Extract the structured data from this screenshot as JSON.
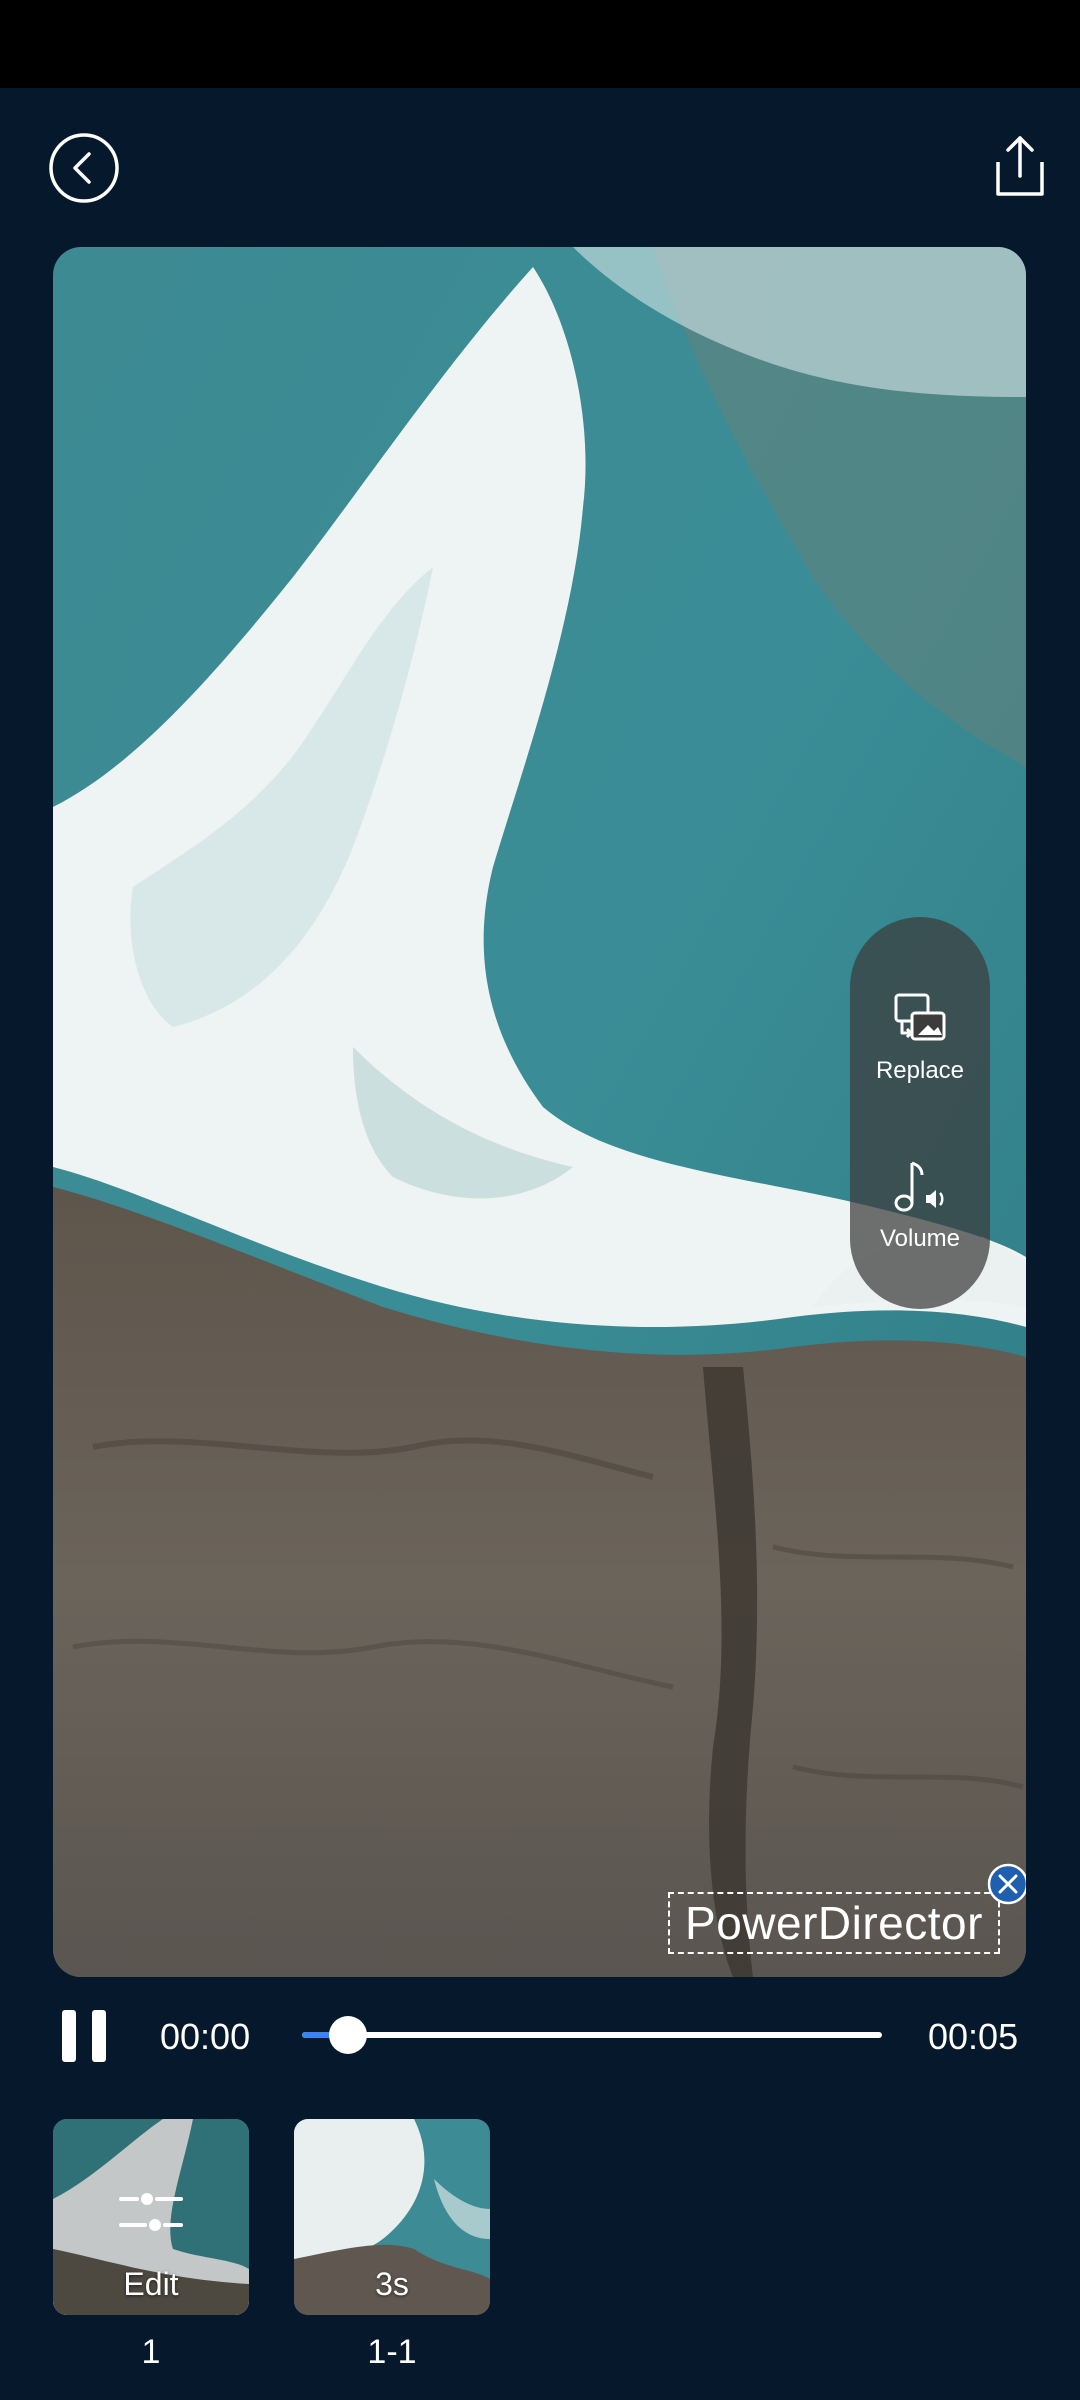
{
  "colors": {
    "background": "#06182b",
    "accent": "#3b82f6",
    "status_bar": "#000000"
  },
  "header": {
    "back_icon": "back-circle-icon",
    "export_icon": "share-upload-icon"
  },
  "preview": {
    "side_actions": [
      {
        "label": "Replace",
        "icon": "replace-icon"
      },
      {
        "label": "Volume",
        "icon": "music-volume-icon"
      }
    ],
    "watermark_text": "PowerDirector",
    "watermark_close_icon": "close-circle-icon"
  },
  "playback": {
    "state_icon": "pause-icon",
    "current_time": "00:00",
    "total_time": "00:05",
    "progress": 0.08
  },
  "clips": [
    {
      "overlay": "Edit",
      "number": "1",
      "selected": true,
      "icon": "adjust-sliders-icon"
    },
    {
      "overlay": "3s",
      "number": "1-1",
      "selected": false
    }
  ]
}
